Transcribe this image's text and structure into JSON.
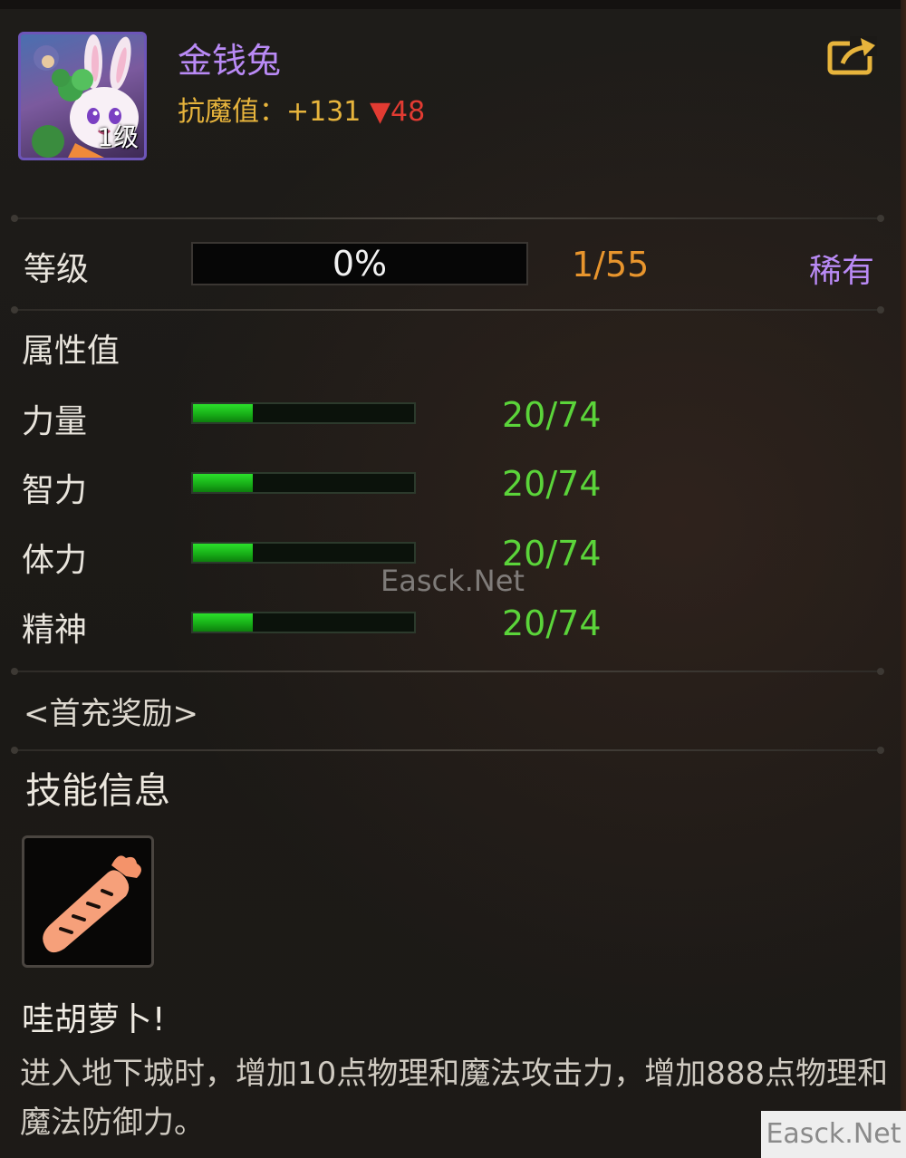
{
  "header": {
    "avatar_level": "1级",
    "pet_name": "金钱兔",
    "resist_label": "抗魔值：",
    "resist_value": "+131",
    "resist_change": "▼48",
    "share_icon": "share-export-icon"
  },
  "level": {
    "label": "等级",
    "progress_text": "0%",
    "progress": 0,
    "count": "1/55",
    "rarity": "稀有"
  },
  "attributes": {
    "title": "属性值",
    "items": [
      {
        "label": "力量",
        "value": "20/74",
        "fill": 0.27
      },
      {
        "label": "智力",
        "value": "20/74",
        "fill": 0.27
      },
      {
        "label": "体力",
        "value": "20/74",
        "fill": 0.27
      },
      {
        "label": "精神",
        "value": "20/74",
        "fill": 0.27
      }
    ]
  },
  "watermark": "Easck.Net",
  "reward": "<首充奖励>",
  "skill": {
    "title": "技能信息",
    "icon": "carrot-icon",
    "name": "哇胡萝卜!",
    "description": "进入地下城时，增加10点物理和魔法攻击力，增加888点物理和魔法防御力。"
  },
  "corner_watermark": "Easck.Net",
  "colors": {
    "pet_name": "#b98af5",
    "resist": "#e7b43c",
    "down": "#e23b32",
    "level_count": "#e8952d",
    "stat_value": "#5bd43a",
    "bar_fill": "#18b018"
  }
}
